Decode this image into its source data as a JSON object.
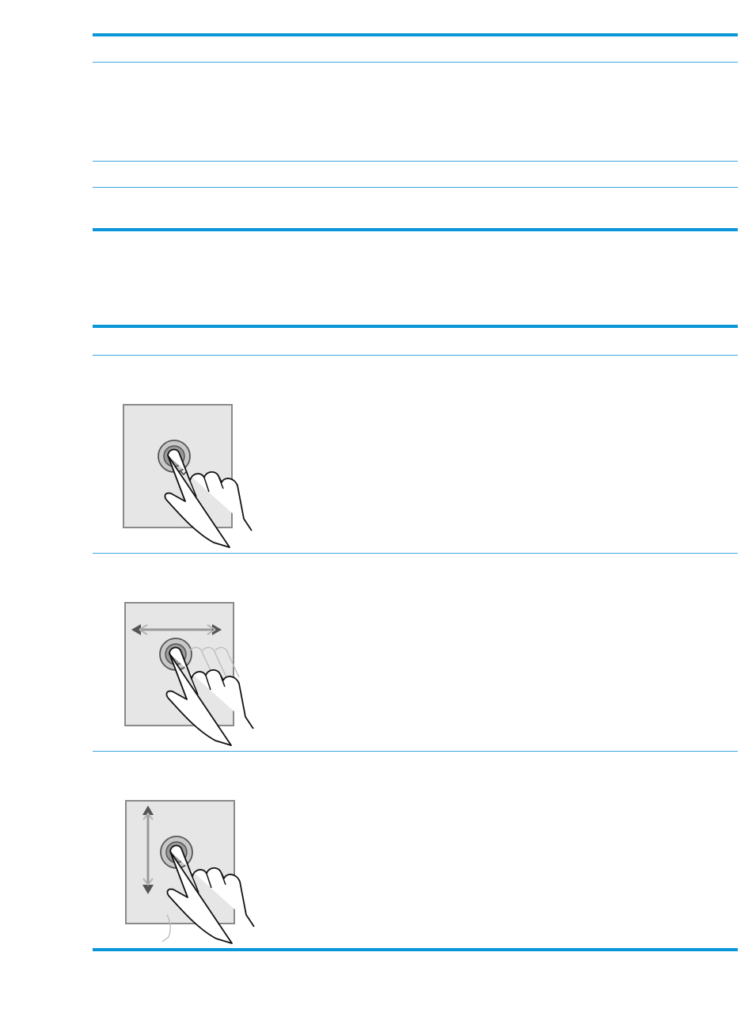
{
  "table1": {
    "rows": [
      {},
      {},
      {}
    ]
  },
  "table2": {
    "rows": [
      {
        "icon": "tap-gesture-icon"
      },
      {
        "icon": "swipe-horizontal-gesture-icon"
      },
      {
        "icon": "scroll-vertical-gesture-icon"
      }
    ]
  }
}
